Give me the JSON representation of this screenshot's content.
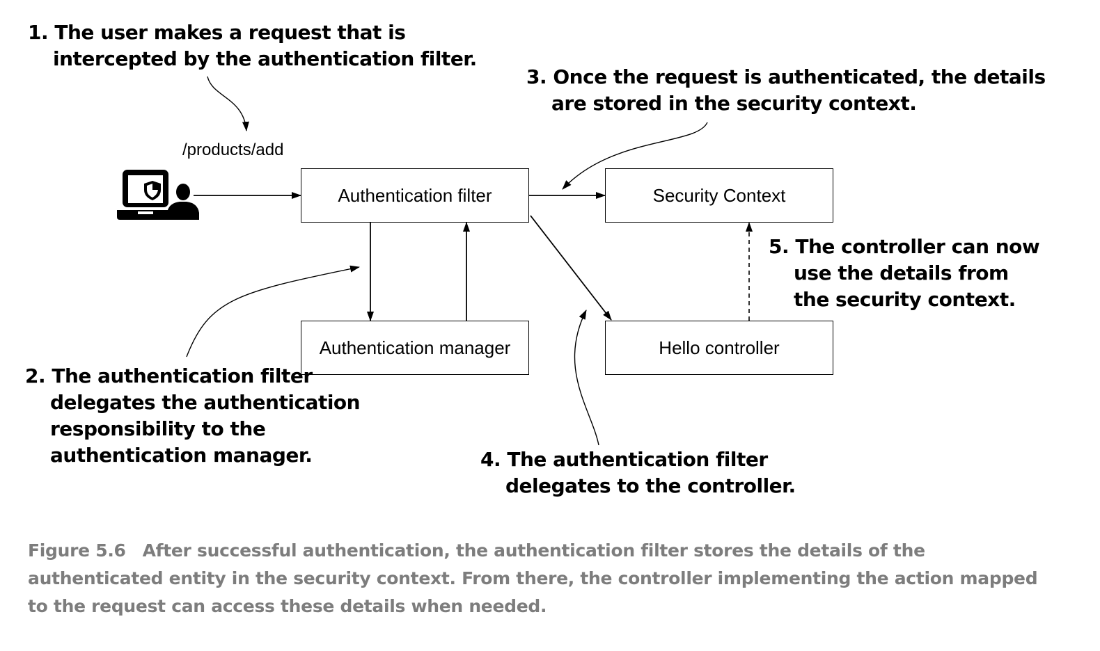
{
  "diagram": {
    "request_path": "/products/add",
    "boxes": {
      "authentication_filter": "Authentication filter",
      "security_context": "Security Context",
      "authentication_manager": "Authentication manager",
      "hello_controller": "Hello controller"
    },
    "notes": {
      "step1": {
        "line1": "1. The user makes a request that is",
        "line2": "intercepted by the authentication filter."
      },
      "step2": {
        "line1": "2. The authentication filter",
        "line2": "delegates the authentication",
        "line3": "responsibility to the",
        "line4": "authentication manager."
      },
      "step3": {
        "line1": "3. Once the request is authenticated, the details",
        "line2": "are stored in the security context."
      },
      "step4": {
        "line1": "4. The authentication filter",
        "line2": "delegates to the controller."
      },
      "step5": {
        "line1": "5. The controller can now",
        "line2": "use the details from",
        "line3": "the security context."
      }
    },
    "icons": [
      "laptop-icon",
      "shield-icon",
      "user-icon"
    ]
  },
  "caption": {
    "label": "Figure 5.6",
    "line1": "After successful authentication, the authentication filter stores the details of the",
    "line2": "authenticated entity in the security context. From there, the controller implementing the action mapped",
    "line3": "to the request can access these details when needed."
  },
  "colors": {
    "caption_text": "#7d7d7d",
    "stroke": "#000000"
  }
}
